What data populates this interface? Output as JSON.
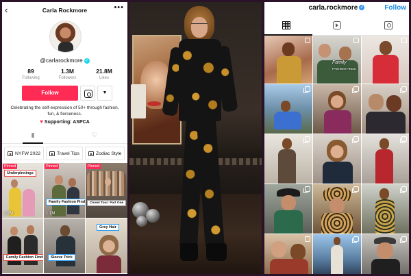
{
  "tiktok": {
    "username": "Carla Rockmore",
    "handle": "@carlarockmore",
    "stats": [
      {
        "value": "89",
        "label": "Following"
      },
      {
        "value": "1.3M",
        "label": "Followers"
      },
      {
        "value": "21.8M",
        "label": "Likes"
      }
    ],
    "follow_label": "Follow",
    "bio": "Celebrating the self-expression of 50+ through fashion, fun, & fierceness.",
    "support_label": "Supporting: ASPCA",
    "playlists": [
      "NYFW 2022",
      "Travel Tips",
      "Zodiac Style"
    ],
    "videos": [
      {
        "pinned": "Pinned",
        "caption": "Underpinnings",
        "views": "2.2M"
      },
      {
        "pinned": "Pinned",
        "caption": "Family Fashion Finds",
        "views": "1.1M"
      },
      {
        "pinned": "Pinned",
        "caption": "Closet Tour: Part One",
        "views": ""
      },
      {
        "pinned": "",
        "caption": "Family Fashion Finds",
        "views": ""
      },
      {
        "pinned": "",
        "caption": "Sleeve Trick",
        "views": ""
      },
      {
        "pinned": "",
        "caption": "Grey Hair",
        "views": ""
      }
    ],
    "colors": {
      "accent": "#fe2c55",
      "verified": "#20d5ec"
    }
  },
  "instagram": {
    "username": "carla.rockmore",
    "follow_label": "Follow",
    "grid_overlay": {
      "title": "Family",
      "subtitle": "FASHION FINDS"
    },
    "colors": {
      "accent": "#1a8ae6"
    }
  }
}
